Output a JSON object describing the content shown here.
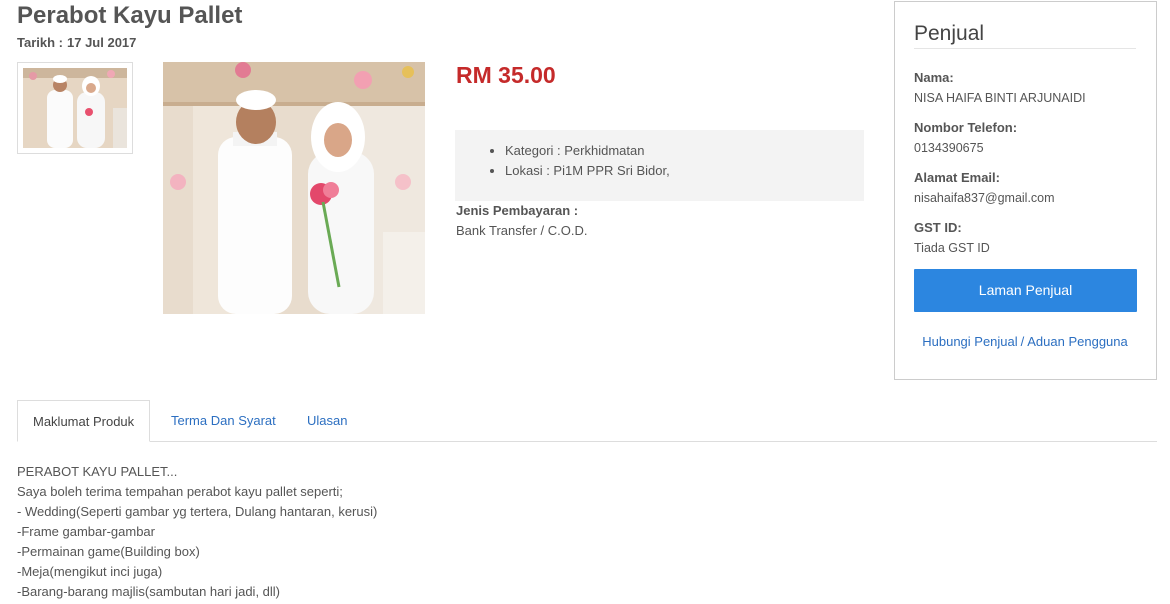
{
  "product": {
    "title": "Perabot Kayu Pallet",
    "date_label": "Tarikh :",
    "date_value": "17 Jul 2017",
    "price": "RM 35.00",
    "details": [
      "Kategori : Perkhidmatan",
      "Lokasi : Pi1M PPR Sri Bidor,"
    ],
    "payment_label": "Jenis Pembayaran :",
    "payment_value": "Bank Transfer / C.O.D."
  },
  "seller": {
    "heading": "Penjual",
    "name_label": "Nama:",
    "name_value": "NISA HAIFA BINTI ARJUNAIDI",
    "phone_label": "Nombor Telefon:",
    "phone_value": "0134390675",
    "email_label": "Alamat Email:",
    "email_value": "nisahaifa837@gmail.com",
    "gst_label": "GST ID:",
    "gst_value": "Tiada GST ID",
    "page_button": "Laman Penjual",
    "contact_link": "Hubungi Penjual",
    "separator": "/",
    "report_link": "Aduan Pengguna"
  },
  "tabs": [
    {
      "label": "Maklumat Produk"
    },
    {
      "label": "Terma Dan Syarat"
    },
    {
      "label": "Ulasan"
    }
  ],
  "description": [
    "PERABOT KAYU PALLET...",
    "Saya boleh terima tempahan perabot kayu pallet seperti;",
    "- Wedding(Seperti gambar yg tertera, Dulang hantaran, kerusi)",
    "-Frame gambar-gambar",
    "-Permainan game(Building box)",
    "-Meja(mengikut inci juga)",
    "-Barang-barang majlis(sambutan hari jadi, dll)"
  ],
  "colors": {
    "price": "#c52a2a",
    "button": "#2c86e0",
    "link": "#2c6fc1"
  }
}
